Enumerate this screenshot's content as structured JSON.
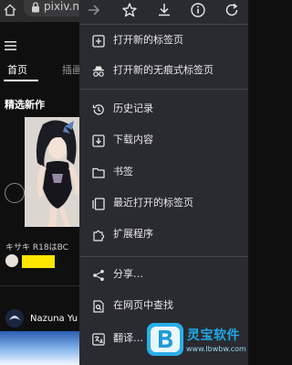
{
  "browser": {
    "url": "pixiv.n",
    "toolbar_icons": [
      "forward-icon",
      "star-icon",
      "download-icon",
      "info-icon",
      "refresh-icon"
    ]
  },
  "page": {
    "tabs": [
      {
        "label": "首页",
        "active": true
      },
      {
        "label": "插画",
        "active": false
      }
    ],
    "section_title": "精选新作",
    "artwork_meta": "キサキ   R18はBC",
    "user_name": "Nazuna Yu"
  },
  "menu": {
    "items": [
      {
        "label": "打开新的标签页",
        "icon": "new-tab-icon"
      },
      {
        "label": "打开新的无痕式标签页",
        "icon": "incognito-icon"
      },
      {
        "label": "历史记录",
        "icon": "history-icon"
      },
      {
        "label": "下载内容",
        "icon": "downloads-icon"
      },
      {
        "label": "书签",
        "icon": "bookmarks-icon"
      },
      {
        "label": "最近打开的标签页",
        "icon": "recent-tabs-icon"
      },
      {
        "label": "扩展程序",
        "icon": "extensions-icon"
      },
      {
        "label": "分享…",
        "icon": "share-icon"
      },
      {
        "label": "在网页中查找",
        "icon": "find-in-page-icon"
      },
      {
        "label": "翻译…",
        "icon": "translate-icon"
      }
    ]
  },
  "watermark": {
    "title": "灵宝软件",
    "url": "www.lbwbw.com"
  },
  "colors": {
    "menu_bg": "#2a2b30",
    "page_bg": "#0f0f10",
    "highlight_yellow": "#ffe600",
    "watermark_blue": "#1ea8e8"
  }
}
